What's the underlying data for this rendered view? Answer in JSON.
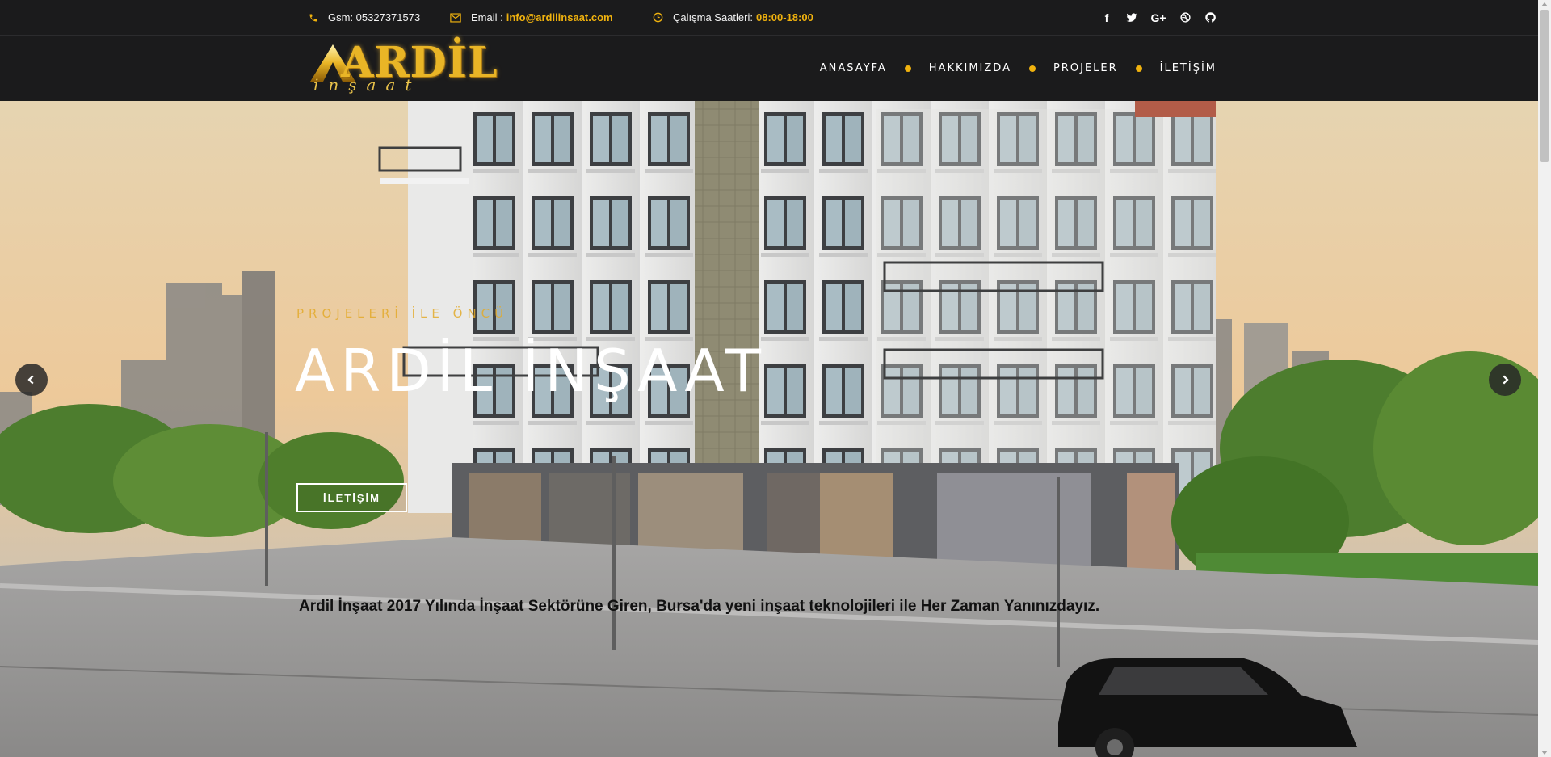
{
  "topbar": {
    "phone_label": "Gsm: 05327371573",
    "email_prefix": "Email :",
    "email_value": "info@ardilinsaat.com",
    "hours_prefix": "Çalışma Saatleri:",
    "hours_value": "08:00-18:00",
    "social_icons": [
      "facebook-icon",
      "twitter-icon",
      "google-plus-icon",
      "dribbble-icon",
      "github-icon"
    ]
  },
  "logo": {
    "word": "ARDİL",
    "sub": "inşaat"
  },
  "nav": {
    "items": [
      {
        "label": "ANASAYFA"
      },
      {
        "label": "HAKKIMIZDA"
      },
      {
        "label": "PROJELER"
      },
      {
        "label": "İLETİŞİM"
      }
    ]
  },
  "hero": {
    "eyebrow": "PROJELERİ İLE ÖNCÜ",
    "title": "ARDİL İNŞAAT",
    "button_label": "İLETİŞİM",
    "description": "Ardil İnşaat 2017 Yılında İnşaat Sektörüne Giren, Bursa'da yeni inşaat teknolojileri ile Her Zaman Yanınızdayız."
  },
  "colors": {
    "accent": "#f0b20e",
    "bar_bg": "#1b1b1c"
  }
}
